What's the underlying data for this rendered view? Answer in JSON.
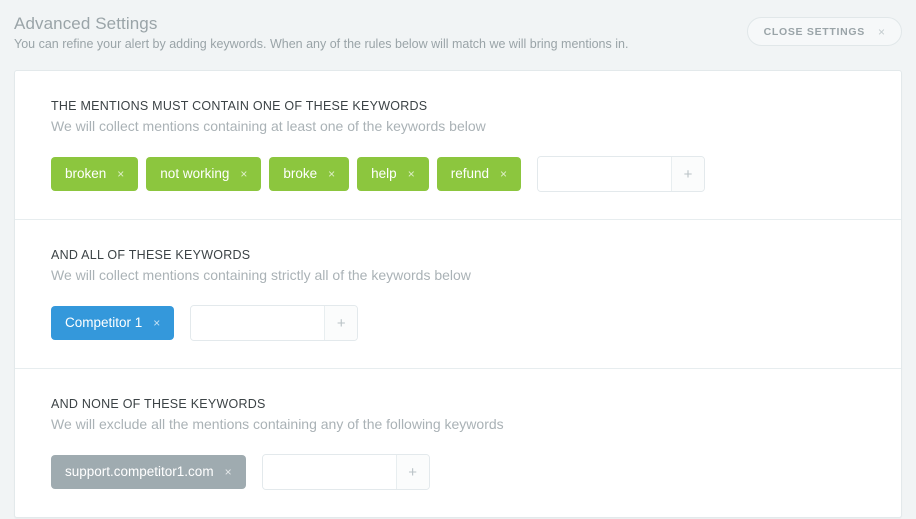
{
  "header": {
    "title": "Advanced Settings",
    "subtitle": "You can refine your alert by adding keywords. When any of the rules below will match we will bring mentions in.",
    "close_button_label": "CLOSE SETTINGS",
    "close_button_icon": "close-icon"
  },
  "colors": {
    "page_background": "#f1f4f5",
    "card_background": "#ffffff",
    "tag_green": "#8cc63e",
    "tag_blue": "#3498db",
    "tag_grey": "#9fabb0",
    "heading_text": "#3c4346",
    "muted_text": "#aab2b6"
  },
  "sections": [
    {
      "heading": "THE MENTIONS MUST CONTAIN ONE OF THESE KEYWORDS",
      "description": "We will collect mentions containing at least one of the keywords below",
      "tag_color": "green",
      "tags": [
        "broken",
        "not working",
        "broke",
        "help",
        "refund"
      ],
      "input": {
        "value": "",
        "placeholder": ""
      },
      "add_label": "+"
    },
    {
      "heading": "AND ALL OF THESE KEYWORDS",
      "description": "We will collect mentions containing strictly all of the keywords below",
      "tag_color": "blue",
      "tags": [
        "Competitor 1"
      ],
      "input": {
        "value": "",
        "placeholder": ""
      },
      "add_label": "+"
    },
    {
      "heading": "AND NONE OF THESE KEYWORDS",
      "description": "We will exclude all the mentions containing any of the following keywords",
      "tag_color": "grey",
      "tags": [
        "support.competitor1.com"
      ],
      "input": {
        "value": "",
        "placeholder": ""
      },
      "add_label": "+"
    }
  ],
  "tag_remove_icon": "×"
}
